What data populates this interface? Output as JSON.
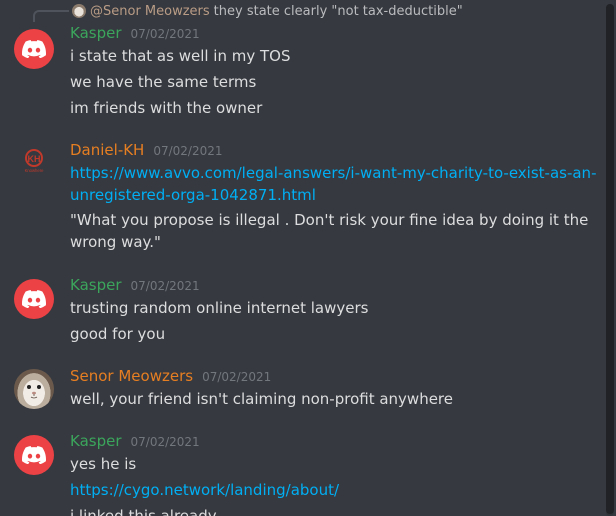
{
  "reply": {
    "username": "@Senor Meowzers",
    "text": "they state clearly \"not tax-deductible\""
  },
  "messages": [
    {
      "username": "Kasper",
      "timestamp": "07/02/2021",
      "avatar": "discord-logo",
      "color": "#3ba55c",
      "lines": [
        "i state that as well in my TOS",
        "we have the same terms",
        "im friends with the owner"
      ]
    },
    {
      "username": "Daniel-KH",
      "timestamp": "07/02/2021",
      "avatar": "kh-logo",
      "color": "#e67e22",
      "avatar_text": "Knowhere",
      "link_line1": "https://www.avvo.com/legal-answers/i-want-my-charity-to-exist-as-an-",
      "link_line2": "unregistered-orga-1042871.html",
      "quote_line1": "\"What you propose is illegal . Don't risk your fine idea by doing it the",
      "quote_line2": "wrong way.\""
    },
    {
      "username": "Kasper",
      "timestamp": "07/02/2021",
      "avatar": "discord-logo",
      "color": "#3ba55c",
      "lines": [
        "trusting random online internet lawyers",
        "good for you"
      ]
    },
    {
      "username": "Senor Meowzers",
      "timestamp": "07/02/2021",
      "avatar": "cat-photo",
      "color": "#e67e22",
      "lines": [
        "well, your friend isn't claiming non-profit anywhere"
      ]
    },
    {
      "username": "Kasper",
      "timestamp": "07/02/2021",
      "avatar": "discord-logo",
      "color": "#3ba55c",
      "lines": [
        "yes he is"
      ],
      "link": "https://cygo.network/landing/about/",
      "partial_line": "i linked this already"
    }
  ]
}
